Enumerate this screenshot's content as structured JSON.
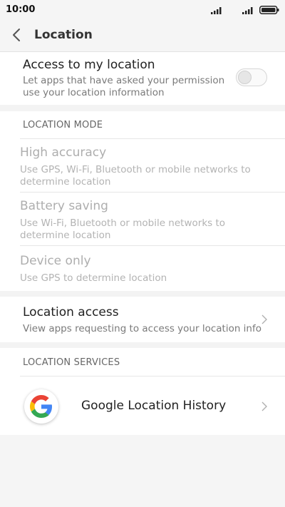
{
  "status_bar": {
    "time": "10:00"
  },
  "title_bar": {
    "title": "Location"
  },
  "access_my_location": {
    "title": "Access to my location",
    "subtitle_line1": "Let apps that have asked your permission",
    "subtitle_line2": "use your location information",
    "enabled": false
  },
  "location_mode": {
    "header": "LOCATION MODE",
    "options": [
      {
        "title": "High accuracy",
        "sub1": "Use GPS, Wi-Fi, Bluetooth or mobile networks to",
        "sub2": "determine location"
      },
      {
        "title": "Battery saving",
        "sub1": "Use Wi-Fi, Bluetooth or mobile networks to",
        "sub2": "determine location"
      },
      {
        "title": "Device only",
        "sub1": "Use GPS to determine location"
      }
    ]
  },
  "location_access": {
    "title": "Location access",
    "subtitle": "View apps requesting to access your location info"
  },
  "location_services": {
    "header": "LOCATION SERVICES",
    "items": [
      {
        "label": "Google Location History",
        "icon": "google-g-icon"
      }
    ]
  },
  "colors": {
    "background": "#f5f5f5",
    "disabled_text": "#aeaeae",
    "divider": "#e6e6e6"
  }
}
